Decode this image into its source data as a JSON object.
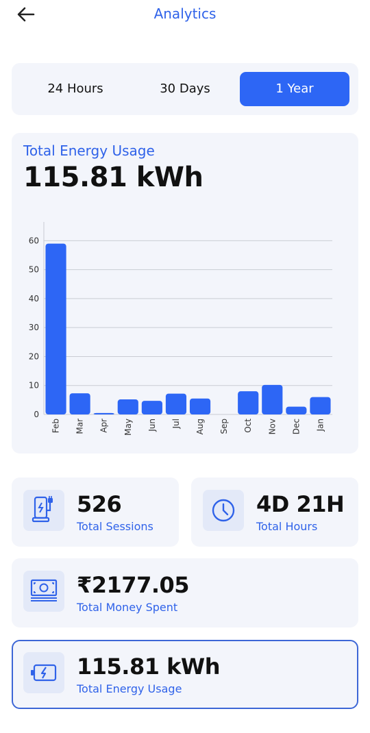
{
  "header": {
    "title": "Analytics"
  },
  "range_tabs": [
    {
      "label": "24 Hours",
      "active": false
    },
    {
      "label": "30 Days",
      "active": false
    },
    {
      "label": "1 Year",
      "active": true
    }
  ],
  "energy_card": {
    "label": "Total Energy Usage",
    "value": "115.81 kWh"
  },
  "chart_data": {
    "type": "bar",
    "categories": [
      "Feb",
      "Mar",
      "Apr",
      "May",
      "Jun",
      "Jul",
      "Aug",
      "Sep",
      "Oct",
      "Nov",
      "Dec",
      "Jan"
    ],
    "values": [
      59,
      7.3,
      0.5,
      5.2,
      4.7,
      7.2,
      5.5,
      0,
      8,
      10.2,
      2.7,
      6
    ],
    "yticks": [
      0,
      10,
      20,
      30,
      40,
      50,
      60
    ],
    "ylim": [
      0,
      66
    ],
    "title": "",
    "xlabel": "",
    "ylabel": "",
    "grid": true,
    "bar_color": "#2d66f5"
  },
  "stats": {
    "sessions": {
      "value": "526",
      "label": "Total Sessions",
      "icon": "charger-icon"
    },
    "hours": {
      "value": "4D 21H",
      "label": "Total Hours",
      "icon": "clock-icon"
    },
    "money": {
      "value": "₹2177.05",
      "label": "Total Money Spent",
      "icon": "cash-icon"
    },
    "energy": {
      "value": "115.81 kWh",
      "label": "Total Energy Usage",
      "icon": "battery-icon"
    }
  },
  "colors": {
    "accent": "#2d66f5",
    "card_bg": "#f3f5fb",
    "icon_bg": "#e3e9f8"
  }
}
